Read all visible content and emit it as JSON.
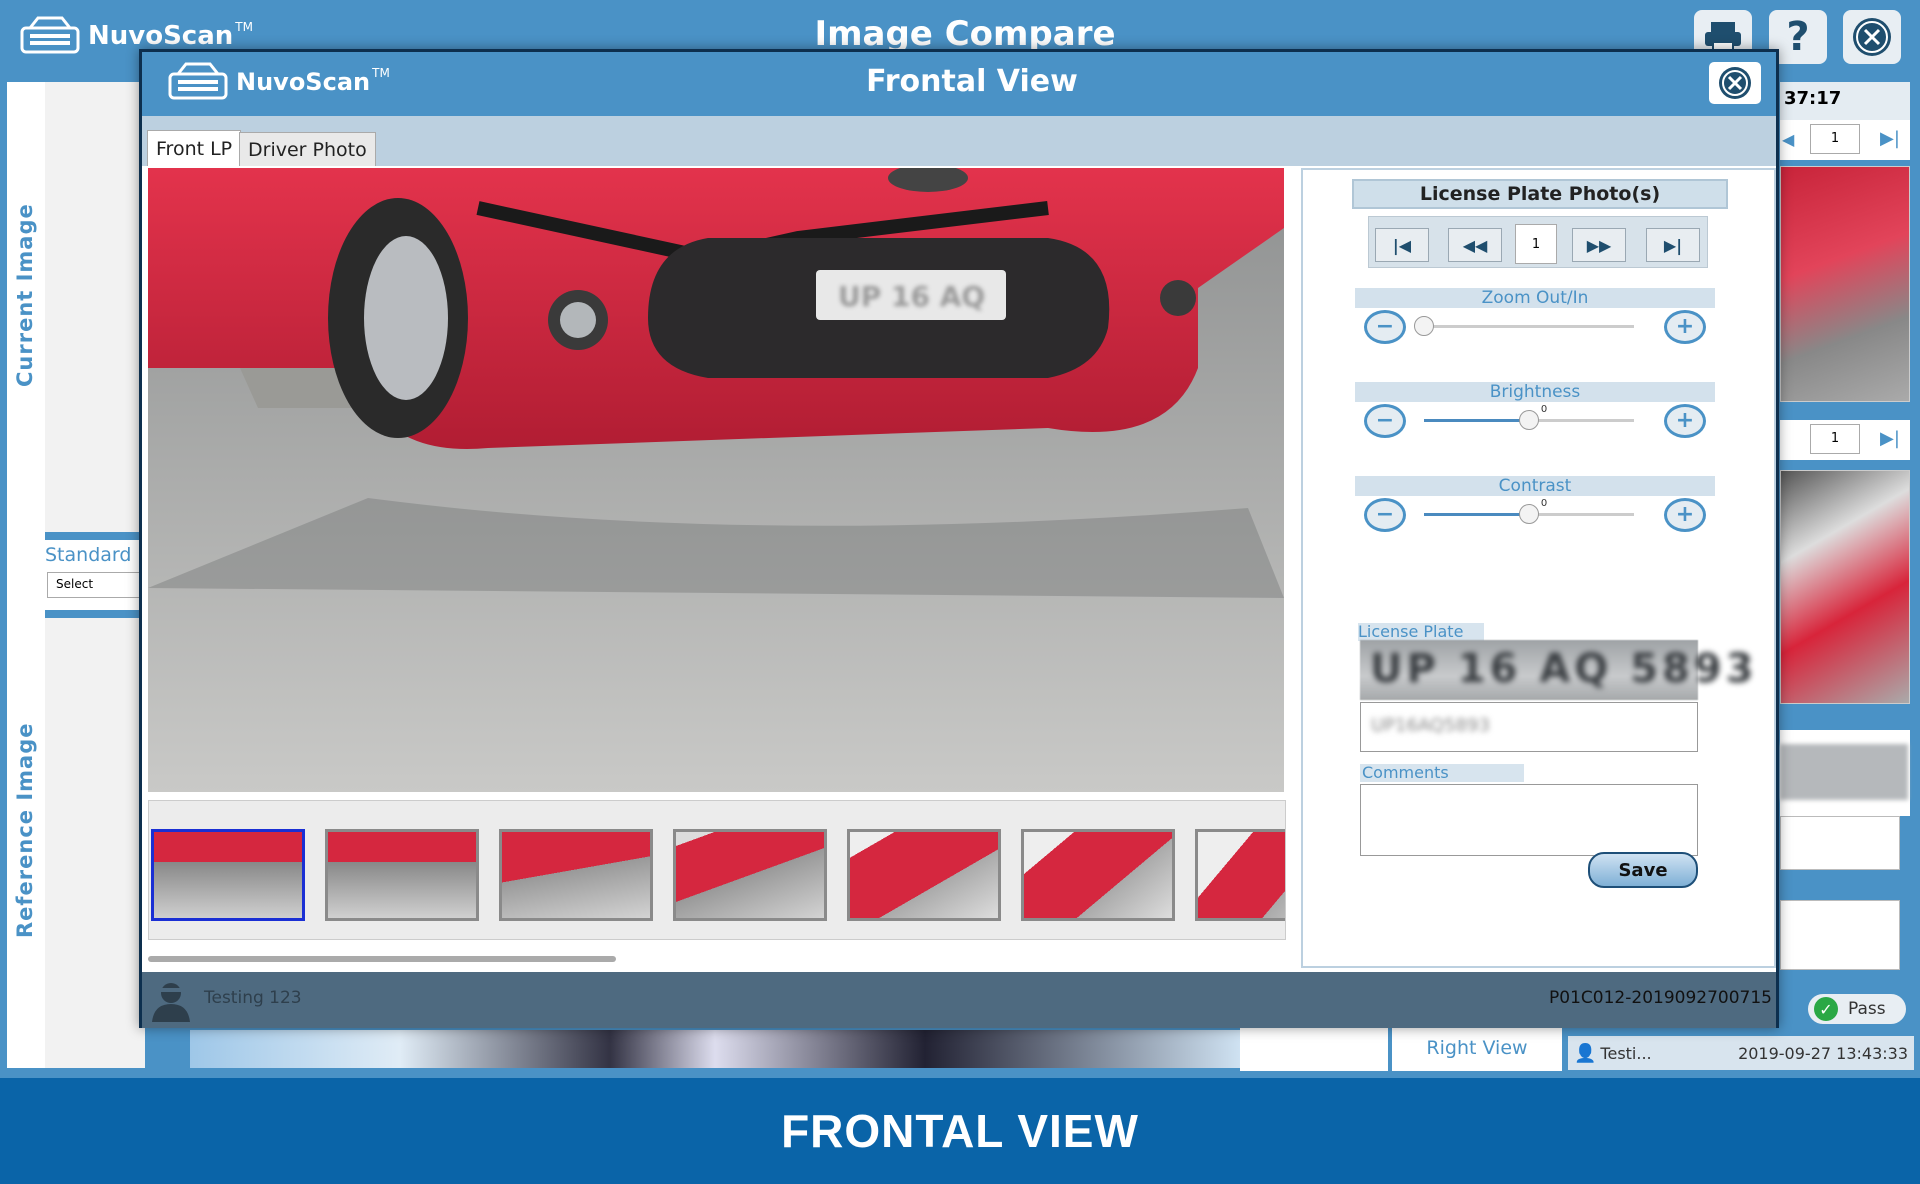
{
  "background_app": {
    "brand": "NuvoScan",
    "trademark": "TM",
    "title": "Image Compare",
    "time_fragment": "37:17",
    "current_image_label": "Current Image",
    "reference_image_label": "Reference Image",
    "standard_label": "Standard",
    "standard_select": "Select",
    "right_view_label": "Right View",
    "page_value_top": "1",
    "page_value_mid": "1",
    "pass_label": "Pass",
    "user_short": "Testi...",
    "timestamp": "2019-09-27 13:43:33"
  },
  "modal": {
    "brand": "NuvoScan",
    "trademark": "TM",
    "title": "Frontal View",
    "tabs": [
      {
        "label": "Front LP",
        "active": true
      },
      {
        "label": "Driver Photo",
        "active": false
      }
    ],
    "thumbnail_count": 7,
    "selected_thumbnail": 0,
    "user_name": "Testing 123",
    "record_id": "P01C012-2019092700715"
  },
  "controls": {
    "lp_photos_title": "License Plate Photo(s)",
    "page_value": "1",
    "zoom_label": "Zoom Out/In",
    "zoom_value": 0,
    "brightness_label": "Brightness",
    "brightness_value": "0",
    "brightness_fraction": 0.5,
    "contrast_label": "Contrast",
    "contrast_value": "0",
    "contrast_fraction": 0.5,
    "license_plate_label": "License Plate",
    "license_plate_image_text": "UP 16 AQ 5893",
    "license_plate_value": "UP16AQ5893",
    "comments_label": "Comments",
    "comments_value": "",
    "save_label": "Save"
  },
  "footer": {
    "caption": "FRONTAL VIEW"
  },
  "colors": {
    "header_blue": "#4a92c6",
    "footer_blue": "#0a64a8",
    "modal_border": "#0d2f4e",
    "selected_thumb": "#1a2fd4"
  }
}
